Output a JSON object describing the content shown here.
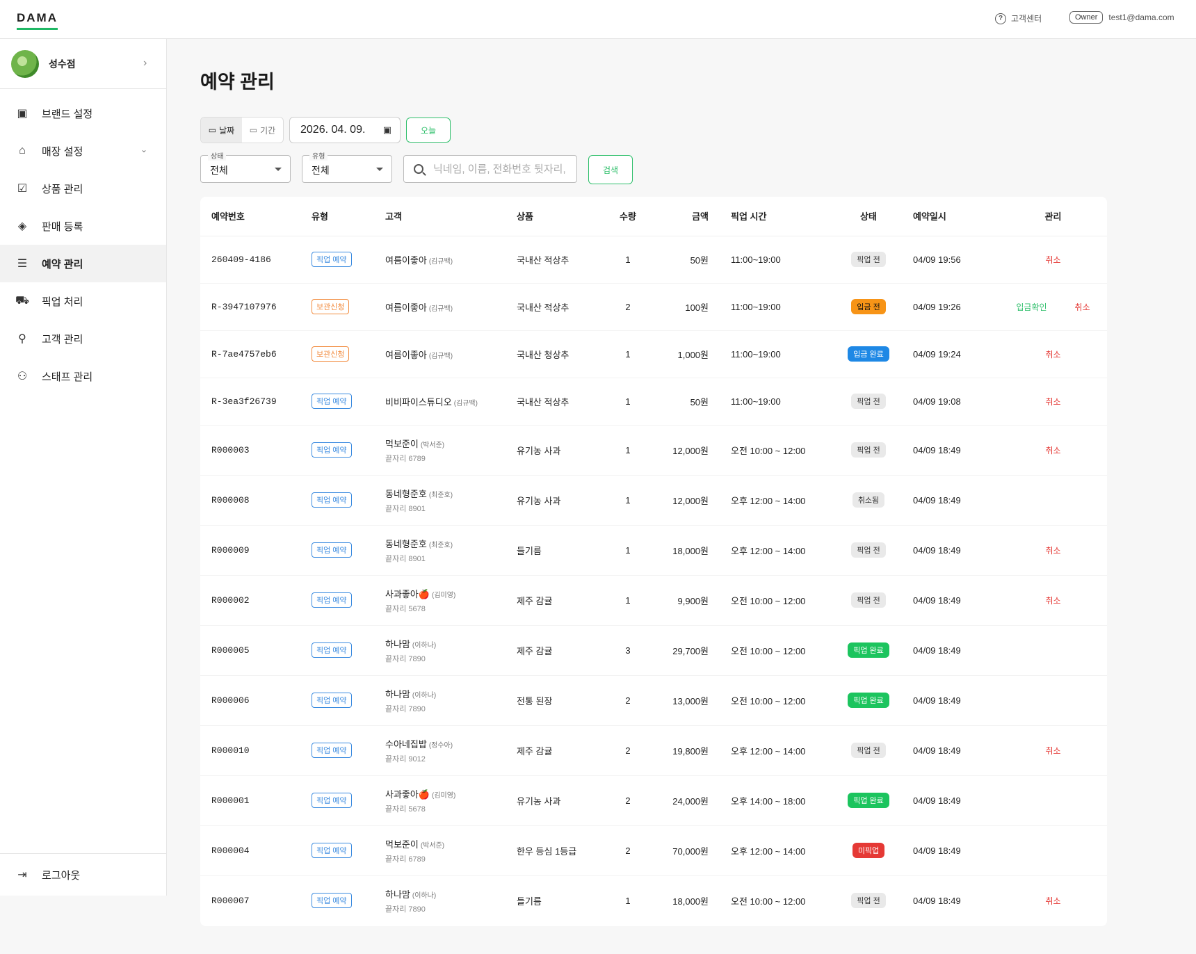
{
  "header": {
    "logo": "DAMA",
    "help": "고객센터",
    "role": "Owner",
    "email": "test1@dama.com"
  },
  "sidebar": {
    "store_name": "성수점",
    "items": [
      {
        "label": "브랜드 설정",
        "icon": "brand-icon",
        "glyph": "▣"
      },
      {
        "label": "매장 설정",
        "icon": "store-icon",
        "glyph": "⌂"
      },
      {
        "label": "상품 관리",
        "icon": "clipboard-icon",
        "glyph": "☑"
      },
      {
        "label": "판매 등록",
        "icon": "tag-icon",
        "glyph": "◈"
      },
      {
        "label": "예약 관리",
        "icon": "list-icon",
        "glyph": "☰"
      },
      {
        "label": "픽업 처리",
        "icon": "truck-icon",
        "glyph": "⛟"
      },
      {
        "label": "고객 관리",
        "icon": "customer-search-icon",
        "glyph": "⚲"
      },
      {
        "label": "스태프 관리",
        "icon": "staff-icon",
        "glyph": "⚇"
      }
    ],
    "logout": "로그아웃"
  },
  "main": {
    "title": "예약 관리",
    "filters": {
      "seg_date": "날짜",
      "seg_period": "기간",
      "date": "2026. 04. 09.",
      "today": "오늘",
      "status_label": "상태",
      "status_value": "전체",
      "type_label": "유형",
      "type_value": "전체",
      "search_placeholder": "닉네임, 이름, 전화번호 뒷자리, 예약번호",
      "search_button": "검색"
    },
    "table": {
      "headers": [
        "예약번호",
        "유형",
        "고객",
        "상품",
        "수량",
        "금액",
        "픽업 시간",
        "상태",
        "예약일시",
        "관리"
      ],
      "rows": [
        {
          "id": "260409-4186",
          "type": "픽업 예약",
          "type_color": "blue",
          "name": "여름이좋아",
          "real": "(김규백)",
          "phone": "",
          "product": "국내산 적상추",
          "qty": "1",
          "amount": "50원",
          "time": "11:00~19:00",
          "status": "픽업 전",
          "status_color": "gray",
          "date": "04/09 19:56",
          "confirm": "",
          "cancel": "취소"
        },
        {
          "id": "R-3947107976",
          "type": "보관신청",
          "type_color": "orange",
          "name": "여름이좋아",
          "real": "(김규백)",
          "phone": "",
          "product": "국내산 적상추",
          "qty": "2",
          "amount": "100원",
          "time": "11:00~19:00",
          "status": "입금 전",
          "status_color": "orange",
          "date": "04/09 19:26",
          "confirm": "입금확인",
          "cancel": "취소"
        },
        {
          "id": "R-7ae4757eb6",
          "type": "보관신청",
          "type_color": "orange",
          "name": "여름이좋아",
          "real": "(김규백)",
          "phone": "",
          "product": "국내산 청상추",
          "qty": "1",
          "amount": "1,000원",
          "time": "11:00~19:00",
          "status": "입금 완료",
          "status_color": "blue",
          "date": "04/09 19:24",
          "confirm": "",
          "cancel": "취소"
        },
        {
          "id": "R-3ea3f26739",
          "type": "픽업 예약",
          "type_color": "blue",
          "name": "비비파이스튜디오",
          "real": "(김규백)",
          "phone": "",
          "product": "국내산 적상추",
          "qty": "1",
          "amount": "50원",
          "time": "11:00~19:00",
          "status": "픽업 전",
          "status_color": "gray",
          "date": "04/09 19:08",
          "confirm": "",
          "cancel": "취소"
        },
        {
          "id": "R000003",
          "type": "픽업 예약",
          "type_color": "blue",
          "name": "먹보준이",
          "real": "(박서준)",
          "phone": "끝자리 6789",
          "product": "유기농 사과",
          "qty": "1",
          "amount": "12,000원",
          "time": "오전 10:00 ~ 12:00",
          "status": "픽업 전",
          "status_color": "gray",
          "date": "04/09 18:49",
          "confirm": "",
          "cancel": "취소"
        },
        {
          "id": "R000008",
          "type": "픽업 예약",
          "type_color": "blue",
          "name": "동네형준호",
          "real": "(최준호)",
          "phone": "끝자리 8901",
          "product": "유기농 사과",
          "qty": "1",
          "amount": "12,000원",
          "time": "오후 12:00 ~ 14:00",
          "status": "취소됨",
          "status_color": "gray",
          "date": "04/09 18:49",
          "confirm": "",
          "cancel": ""
        },
        {
          "id": "R000009",
          "type": "픽업 예약",
          "type_color": "blue",
          "name": "동네형준호",
          "real": "(최준호)",
          "phone": "끝자리 8901",
          "product": "들기름",
          "qty": "1",
          "amount": "18,000원",
          "time": "오후 12:00 ~ 14:00",
          "status": "픽업 전",
          "status_color": "gray",
          "date": "04/09 18:49",
          "confirm": "",
          "cancel": "취소"
        },
        {
          "id": "R000002",
          "type": "픽업 예약",
          "type_color": "blue",
          "name": "사과좋아🍎",
          "real": "(김미영)",
          "phone": "끝자리 5678",
          "product": "제주 감귤",
          "qty": "1",
          "amount": "9,900원",
          "time": "오전 10:00 ~ 12:00",
          "status": "픽업 전",
          "status_color": "gray",
          "date": "04/09 18:49",
          "confirm": "",
          "cancel": "취소"
        },
        {
          "id": "R000005",
          "type": "픽업 예약",
          "type_color": "blue",
          "name": "하나맘",
          "real": "(이하나)",
          "phone": "끝자리 7890",
          "product": "제주 감귤",
          "qty": "3",
          "amount": "29,700원",
          "time": "오전 10:00 ~ 12:00",
          "status": "픽업 완료",
          "status_color": "green",
          "date": "04/09 18:49",
          "confirm": "",
          "cancel": ""
        },
        {
          "id": "R000006",
          "type": "픽업 예약",
          "type_color": "blue",
          "name": "하나맘",
          "real": "(이하나)",
          "phone": "끝자리 7890",
          "product": "전통 된장",
          "qty": "2",
          "amount": "13,000원",
          "time": "오전 10:00 ~ 12:00",
          "status": "픽업 완료",
          "status_color": "green",
          "date": "04/09 18:49",
          "confirm": "",
          "cancel": ""
        },
        {
          "id": "R000010",
          "type": "픽업 예약",
          "type_color": "blue",
          "name": "수아네집밥",
          "real": "(정수아)",
          "phone": "끝자리 9012",
          "product": "제주 감귤",
          "qty": "2",
          "amount": "19,800원",
          "time": "오후 12:00 ~ 14:00",
          "status": "픽업 전",
          "status_color": "gray",
          "date": "04/09 18:49",
          "confirm": "",
          "cancel": "취소"
        },
        {
          "id": "R000001",
          "type": "픽업 예약",
          "type_color": "blue",
          "name": "사과좋아🍎",
          "real": "(김미영)",
          "phone": "끝자리 5678",
          "product": "유기농 사과",
          "qty": "2",
          "amount": "24,000원",
          "time": "오후 14:00 ~ 18:00",
          "status": "픽업 완료",
          "status_color": "green",
          "date": "04/09 18:49",
          "confirm": "",
          "cancel": ""
        },
        {
          "id": "R000004",
          "type": "픽업 예약",
          "type_color": "blue",
          "name": "먹보준이",
          "real": "(박서준)",
          "phone": "끝자리 6789",
          "product": "한우 등심 1등급",
          "qty": "2",
          "amount": "70,000원",
          "time": "오후 12:00 ~ 14:00",
          "status": "미픽업",
          "status_color": "red",
          "date": "04/09 18:49",
          "confirm": "",
          "cancel": ""
        },
        {
          "id": "R000007",
          "type": "픽업 예약",
          "type_color": "blue",
          "name": "하나맘",
          "real": "(이하나)",
          "phone": "끝자리 7890",
          "product": "들기름",
          "qty": "1",
          "amount": "18,000원",
          "time": "오전 10:00 ~ 12:00",
          "status": "픽업 전",
          "status_color": "gray",
          "date": "04/09 18:49",
          "confirm": "",
          "cancel": "취소"
        }
      ]
    }
  }
}
